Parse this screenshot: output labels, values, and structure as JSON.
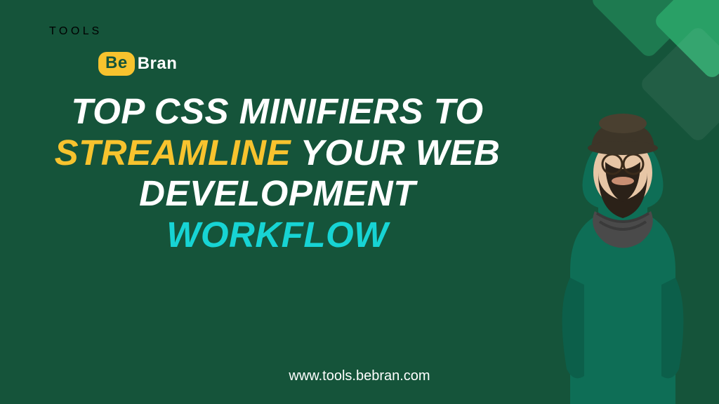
{
  "logo": {
    "be": "Be",
    "bran": "Bran",
    "sub": "T O O L S"
  },
  "headline": {
    "line1_a": "TOP CSS MINIFIERS TO",
    "line2_a": "STREAMLINE",
    "line2_b": " YOUR WEB",
    "line3_a": "DEVELOPMENT ",
    "line3_b": "WORKFLOW"
  },
  "footer": {
    "url": "www.tools.bebran.com"
  },
  "colors": {
    "bg": "#15543a",
    "accent_yellow": "#f7c32e",
    "accent_cyan": "#17d4d4",
    "text": "#ffffff"
  },
  "person": {
    "desc": "bearded-man-green-sweater-hat-glasses"
  }
}
